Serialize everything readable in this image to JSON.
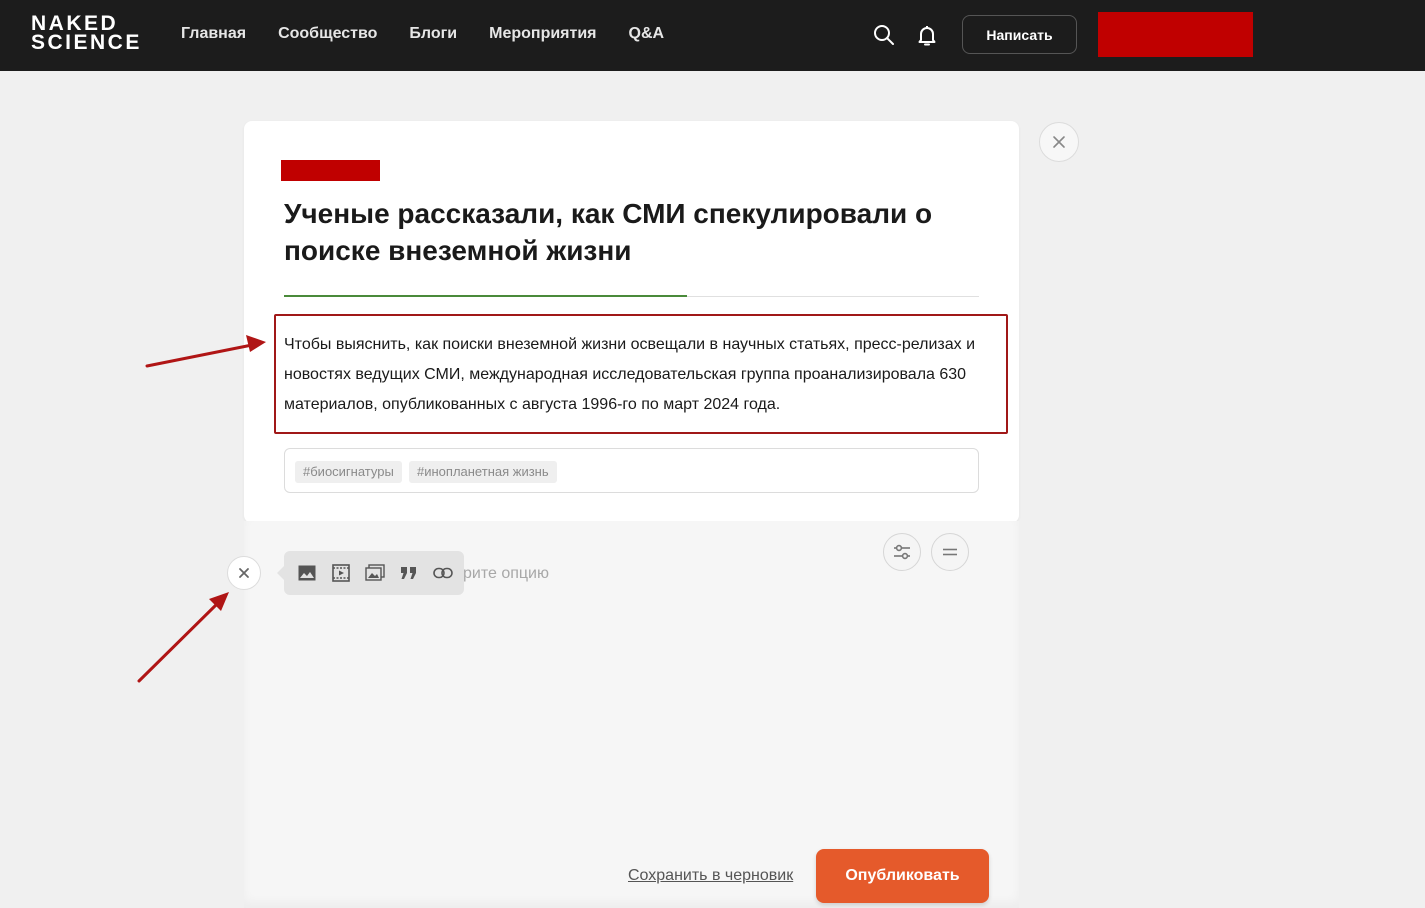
{
  "header": {
    "logo_line1": "NAKED",
    "logo_line2": "SCIENCE",
    "nav": [
      "Главная",
      "Сообщество",
      "Блоги",
      "Мероприятия",
      "Q&A"
    ],
    "write_button": "Написать",
    "icons": [
      "search-icon",
      "bell-icon"
    ]
  },
  "article": {
    "title": "Ученые рассказали, как СМИ спекулировали о поиске внеземной жизни",
    "lead": "Чтобы выяснить, как поиски внеземной жизни освещали в научных статьях, пресс-релизах и новостях ведущих СМИ, международная исследовательская группа проанализировала 630 материалов, опубликованных с августа 1996-го по март 2024 года.",
    "tags": [
      "#биосигнатуры",
      "#инопланетная жизнь"
    ]
  },
  "editor": {
    "option_hint": "рите опцию",
    "toolbar_icons": [
      "image-icon",
      "video-icon",
      "gallery-icon",
      "quote-icon",
      "link-icon"
    ],
    "side_icons": [
      "settings-sliders-icon",
      "separator-icon"
    ]
  },
  "footer": {
    "save_draft": "Сохранить в черновик",
    "publish": "Опубликовать"
  },
  "colors": {
    "header_bg": "#1c1c1c",
    "accent_red": "#c00000",
    "publish_orange": "#e55a2b",
    "annotation_red": "#b01515"
  }
}
